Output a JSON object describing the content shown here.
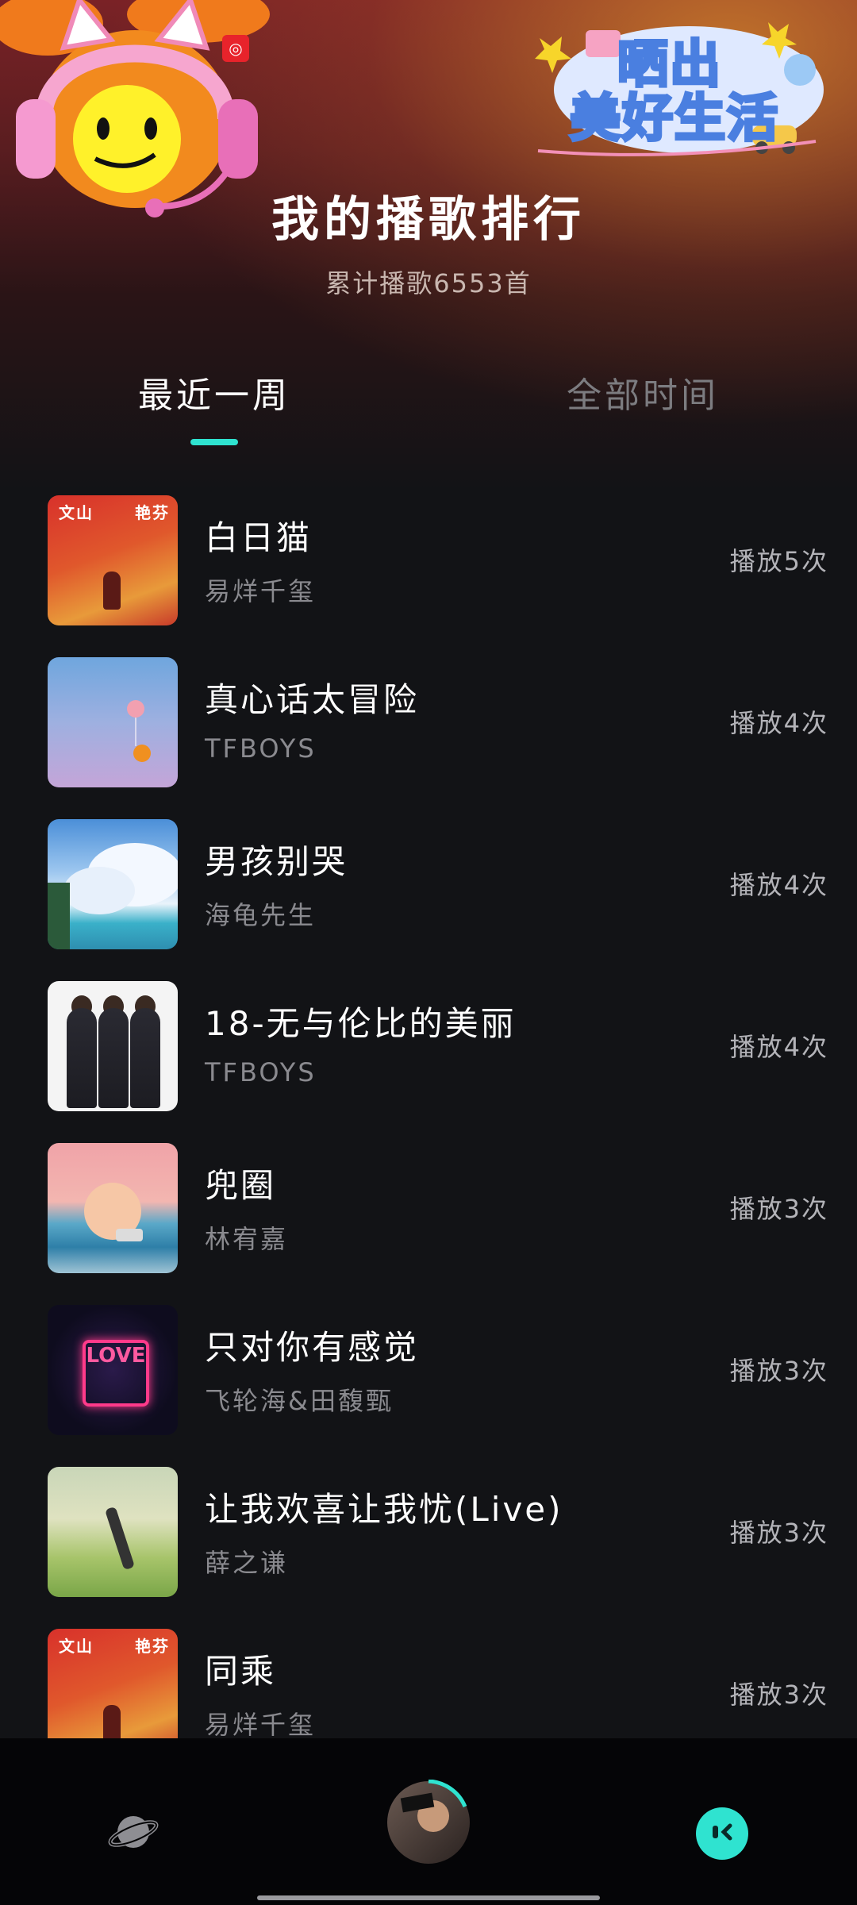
{
  "header": {
    "title": "我的播歌排行",
    "subtitle": "累计播歌6553首",
    "sticker_text": [
      "晒出",
      "美好生活"
    ],
    "colors": {
      "accent": "#2fe3d0",
      "header_top": "#7a2226",
      "background": "#121316"
    }
  },
  "tabs": [
    {
      "label": "最近一周",
      "active": true
    },
    {
      "label": "全部时间",
      "active": false
    }
  ],
  "songs": [
    {
      "title": "白日猫",
      "artist": "易烊千玺",
      "plays": "播放5次",
      "cover_text": [
        "文山",
        "艳芬"
      ]
    },
    {
      "title": "真心话太冒险",
      "artist": "TFBOYS",
      "plays": "播放4次"
    },
    {
      "title": "男孩别哭",
      "artist": "海龟先生",
      "plays": "播放4次"
    },
    {
      "title": "18-无与伦比的美丽",
      "artist": "TFBOYS",
      "plays": "播放4次"
    },
    {
      "title": "兜圈",
      "artist": "林宥嘉",
      "plays": "播放3次"
    },
    {
      "title": "只对你有感觉",
      "artist": "飞轮海&田馥甄",
      "plays": "播放3次",
      "cover_text": "LOVE"
    },
    {
      "title": "让我欢喜让我忧(Live)",
      "artist": "薛之谦",
      "plays": "播放3次"
    },
    {
      "title": "同乘",
      "artist": "易烊千玺",
      "plays": "播放3次",
      "cover_text": [
        "文山",
        "艳芬"
      ]
    }
  ],
  "bottom_nav": [
    {
      "icon": "planet-icon"
    },
    {
      "icon": "now-playing-avatar"
    },
    {
      "icon": "smiley-face-icon"
    }
  ]
}
